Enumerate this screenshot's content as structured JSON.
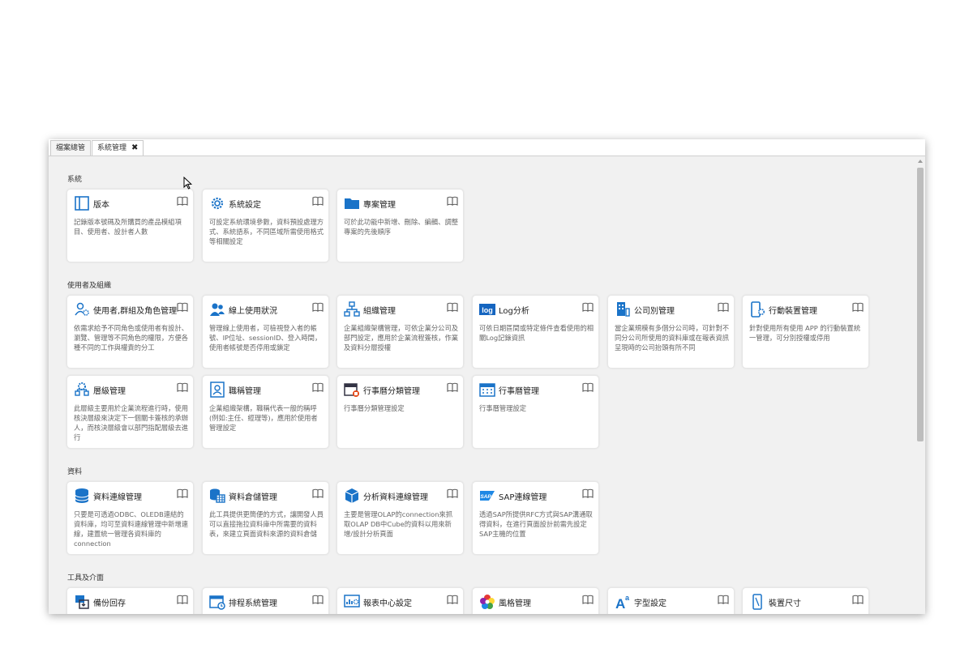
{
  "tabs": [
    {
      "label": "檔案總管",
      "active": false
    },
    {
      "label": "系統管理",
      "active": true,
      "close": "✖"
    }
  ],
  "sections": [
    {
      "title": "系統"
    },
    {
      "title": "使用者及組織"
    },
    {
      "title": "資料"
    },
    {
      "title": "工具及介面"
    }
  ],
  "cards": [
    {
      "title": "版本",
      "icon": "book-panel-icon",
      "desc": "記錄版本號碼及所購買的產品模組項目、使用者、設計者人數"
    },
    {
      "title": "系統設定",
      "icon": "gear-icon",
      "desc": "可設定系統環境參數，資料預設處理方式、系統語系，不同區域所需使用格式等相關設定"
    },
    {
      "title": "專案管理",
      "icon": "folder-icon",
      "desc": "可於此功能中新增、刪除、編輯、調整專案的先後順序"
    },
    {
      "title": "使用者,群組及角色管理",
      "icon": "users-gear-icon",
      "desc": "依需求給予不同角色或使用者有設計、瀏覽、管理等不同角色的權限，方便各種不同的工作與權責的分工"
    },
    {
      "title": "線上使用狀況",
      "icon": "online-users-icon",
      "desc": "管理線上使用者，可檢視登入者的帳號、IP位址、sessionID、登入時間，使用者帳號是否停用或鎖定"
    },
    {
      "title": "組織管理",
      "icon": "org-chart-icon",
      "desc": "企業組織架構管理，可依企業分公司及部門設定，應用於企業流程簽核，作業及資料分層授權"
    },
    {
      "title": "Log分析",
      "icon": "log-icon",
      "desc": "可依日期區間或特定條件查看使用的相關Log記錄資訊"
    },
    {
      "title": "公司別管理",
      "icon": "company-building-icon",
      "desc": "當企業規模有多個分公司時，可針對不同分公司所使用的資料庫或在報表資訊呈現時的公司抬頭有所不同"
    },
    {
      "title": "行動裝置管理",
      "icon": "mobile-gear-icon",
      "desc": "針對使用所有使用 APP 的行動裝置統一管理，可分別授權或停用"
    },
    {
      "title": "層級管理",
      "icon": "hierarchy-gear-icon",
      "desc": "此層級主要用於企業流程進行時，使用核決層級來決定下一個關卡簽核的承辦人，而核決層級會以部門指配層級去進行"
    },
    {
      "title": "職稱管理",
      "icon": "job-title-icon",
      "desc": "企業組織架構，職稱代表一般的稱呼(例如:主任、經理等)，應用於使用者管理設定"
    },
    {
      "title": "行事曆分類管理",
      "icon": "calendar-category-icon",
      "desc": "行事曆分類管理設定"
    },
    {
      "title": "行事曆管理",
      "icon": "calendar-icon",
      "desc": "行事曆管理設定"
    },
    {
      "title": "資料連線管理",
      "icon": "database-icon",
      "desc": "只要是可透過ODBC、OLEDB連結的資料庫，均可至資料連線管理中新增連線，建置統一管理各資料庫的connection"
    },
    {
      "title": "資料倉儲管理",
      "icon": "data-warehouse-icon",
      "desc": "此工具提供更簡便的方式，讓開發人員可以直接拖拉資料庫中所需要的資料表，來建立頁面資料來源的資料倉儲"
    },
    {
      "title": "分析資料連線管理",
      "icon": "olap-cube-icon",
      "desc": "主要是管理OLAP的connection來抓取OLAP DB中Cube的資料以用來新增/設計分析頁面"
    },
    {
      "title": "SAP連線管理",
      "icon": "sap-icon",
      "desc": "透過SAP所提供RFC方式與SAP溝通取得資料，在進行頁面設計前需先設定SAP主機的位置"
    },
    {
      "title": "備份回存",
      "icon": "backup-restore-icon",
      "desc": ""
    },
    {
      "title": "排程系統管理",
      "icon": "schedule-icon",
      "desc": ""
    },
    {
      "title": "報表中心設定",
      "icon": "report-center-icon",
      "desc": ""
    },
    {
      "title": "風格管理",
      "icon": "color-palette-icon",
      "desc": ""
    },
    {
      "title": "字型設定",
      "icon": "font-icon",
      "desc": ""
    },
    {
      "title": "裝置尺寸",
      "icon": "device-size-icon",
      "desc": ""
    }
  ],
  "colors": {
    "icon_blue": "#1a73c8",
    "log_blue": "#1565c0",
    "window_bg": "#f1f1f1"
  }
}
